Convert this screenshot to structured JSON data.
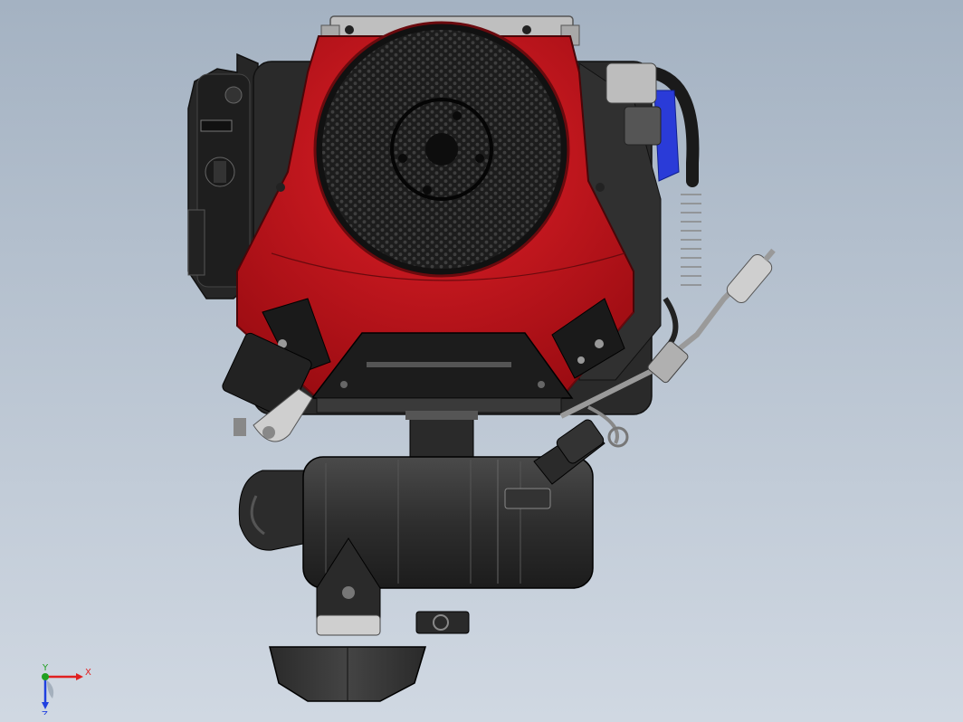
{
  "viewport": {
    "background_top": "#a4b2c2",
    "background_bottom": "#d0d8e2"
  },
  "model": {
    "shroud_color": "#c8141c",
    "body_color": "#2a2a2a",
    "metal_color": "#c8c8c8",
    "hose_accent_color": "#2a3bd8"
  },
  "triad": {
    "x_label": "X",
    "y_label": "Y",
    "z_label": "Z",
    "x_color": "#e02020",
    "y_color": "#20a020",
    "z_color": "#2040e0"
  }
}
